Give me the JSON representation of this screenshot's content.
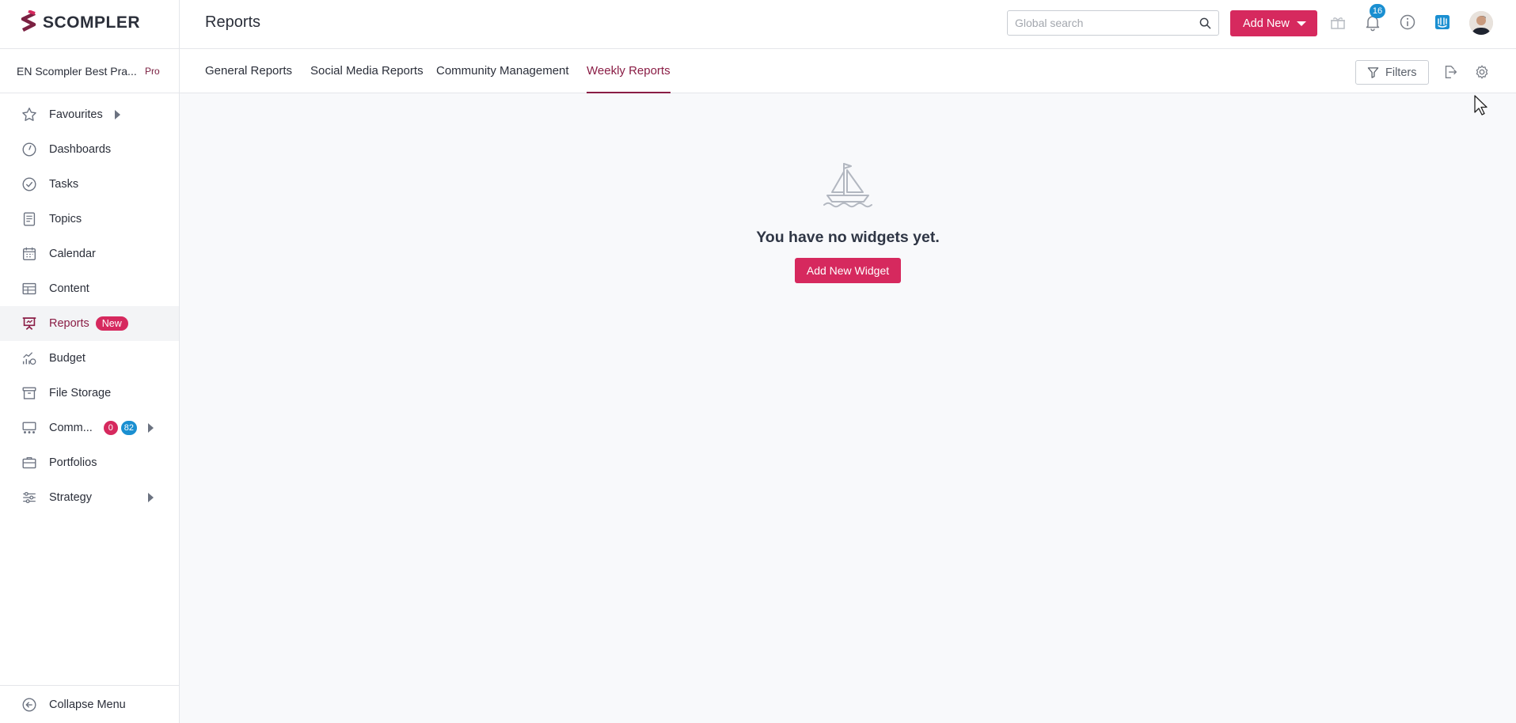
{
  "brand": {
    "name": "SCOMPLER",
    "accent": "#d6295e",
    "active_color": "#8a1d45"
  },
  "workspace": {
    "name": "EN Scompler Best Pra...",
    "plan": "Pro"
  },
  "sidebar": {
    "items": [
      {
        "label": "Favourites",
        "icon": "star-icon"
      },
      {
        "label": "Dashboards",
        "icon": "gauge-icon"
      },
      {
        "label": "Tasks",
        "icon": "check-circle-icon"
      },
      {
        "label": "Topics",
        "icon": "document-icon"
      },
      {
        "label": "Calendar",
        "icon": "calendar-icon"
      },
      {
        "label": "Content",
        "icon": "table-icon"
      },
      {
        "label": "Reports",
        "icon": "presentation-icon",
        "badge": "New",
        "active": true
      },
      {
        "label": "Budget",
        "icon": "budget-chart-icon"
      },
      {
        "label": "File Storage",
        "icon": "archive-icon"
      },
      {
        "label": "Comm...",
        "icon": "community-icon",
        "count_red": "0",
        "count_blue": "82"
      },
      {
        "label": "Portfolios",
        "icon": "briefcase-icon"
      },
      {
        "label": "Strategy",
        "icon": "sliders-icon"
      }
    ],
    "collapse_label": "Collapse Menu"
  },
  "header": {
    "title": "Reports",
    "search_placeholder": "Global search",
    "add_new_label": "Add New",
    "notification_count": "16"
  },
  "tabs": [
    {
      "label": "General Reports"
    },
    {
      "label": "Social Media Reports"
    },
    {
      "label": "Community Management"
    },
    {
      "label": "Weekly Reports",
      "active": true
    }
  ],
  "toolbar": {
    "filters_label": "Filters"
  },
  "main": {
    "empty_text": "You have no widgets yet.",
    "add_widget_label": "Add New Widget"
  }
}
